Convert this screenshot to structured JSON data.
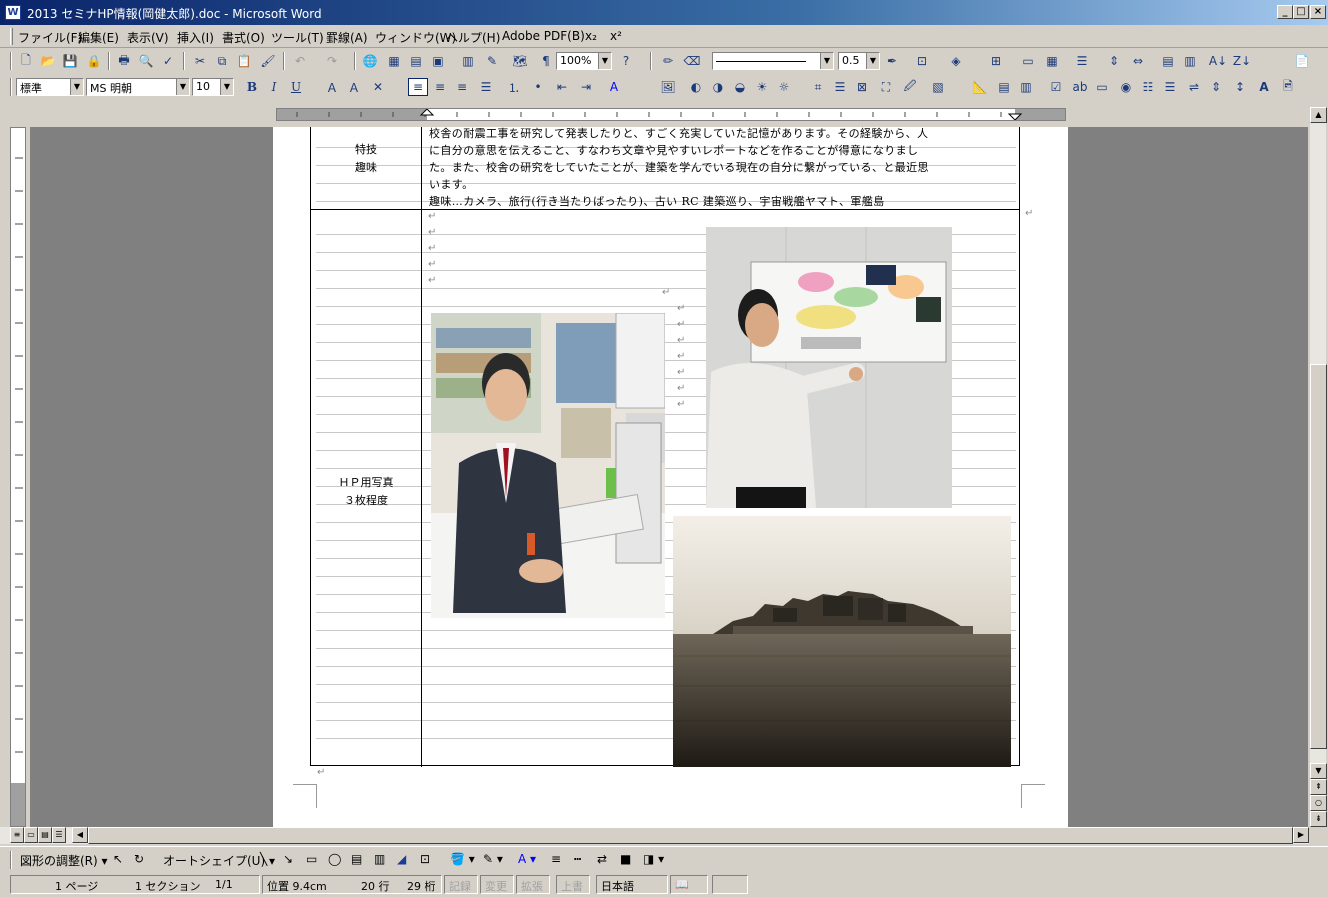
{
  "window": {
    "title": "2013 セミナHP情報(岡健太郎).doc - Microsoft Word",
    "app_icon": "W"
  },
  "menu": [
    {
      "label": "ファイル(F)"
    },
    {
      "label": "編集(E)"
    },
    {
      "label": "表示(V)"
    },
    {
      "label": "挿入(I)"
    },
    {
      "label": "書式(O)"
    },
    {
      "label": "ツール(T)"
    },
    {
      "label": "罫線(A)"
    },
    {
      "label": "ウィンドウ(W)"
    },
    {
      "label": "ヘルプ(H)"
    },
    {
      "label": "Adobe PDF(B)"
    },
    {
      "label": "x₂"
    },
    {
      "label": "x²"
    }
  ],
  "toolbar": {
    "zoom": "100%",
    "line_width": "0.5",
    "style": "標準",
    "font": "MS 明朝",
    "size": "10",
    "bold": "B",
    "italic": "I",
    "underline": "U"
  },
  "document": {
    "row1_labels": [
      "特技",
      "趣味"
    ],
    "row1_text": [
      "校舎の耐震工事を研究して発表したりと、すごく充実していた記憶があります。その経験から、人",
      "に自分の意思を伝えること、すなわち文章や見やすいレポートなどを作ることが得意になりまし",
      "た。また、校舎の研究をしていたことが、建築を学んでいる現在の自分に繋がっている、と最近思",
      "います。",
      "趣味…カメラ、旅行(行き当たりばったり)、古い RC 建築巡り、宇宙戦艦ヤマト、軍艦島"
    ],
    "row2_labels": [
      "ＨＰ用写真",
      "３枚程度"
    ],
    "photos": [
      {
        "name": "student-at-computer-photo"
      },
      {
        "name": "student-presenting-poster-photo"
      },
      {
        "name": "gunkanjima-island-photo"
      }
    ],
    "para_mark": "↵"
  },
  "status": {
    "page": "1 ページ",
    "section": "1 セクション",
    "pages": "1/1",
    "position": "位置 9.4cm",
    "line": "20 行",
    "col": "29 桁",
    "rec": "記録",
    "trk": "変更",
    "ext": "拡張",
    "ovr": "上書",
    "lang": "日本語"
  },
  "drawbar": {
    "adjust": "図形の調整(R)",
    "autoshape": "オートシェイプ(U)"
  },
  "colors": {
    "title_start": "#0a246a",
    "title_end": "#a6caf0",
    "chrome": "#d4d0c8",
    "doc_bg": "#808080"
  }
}
